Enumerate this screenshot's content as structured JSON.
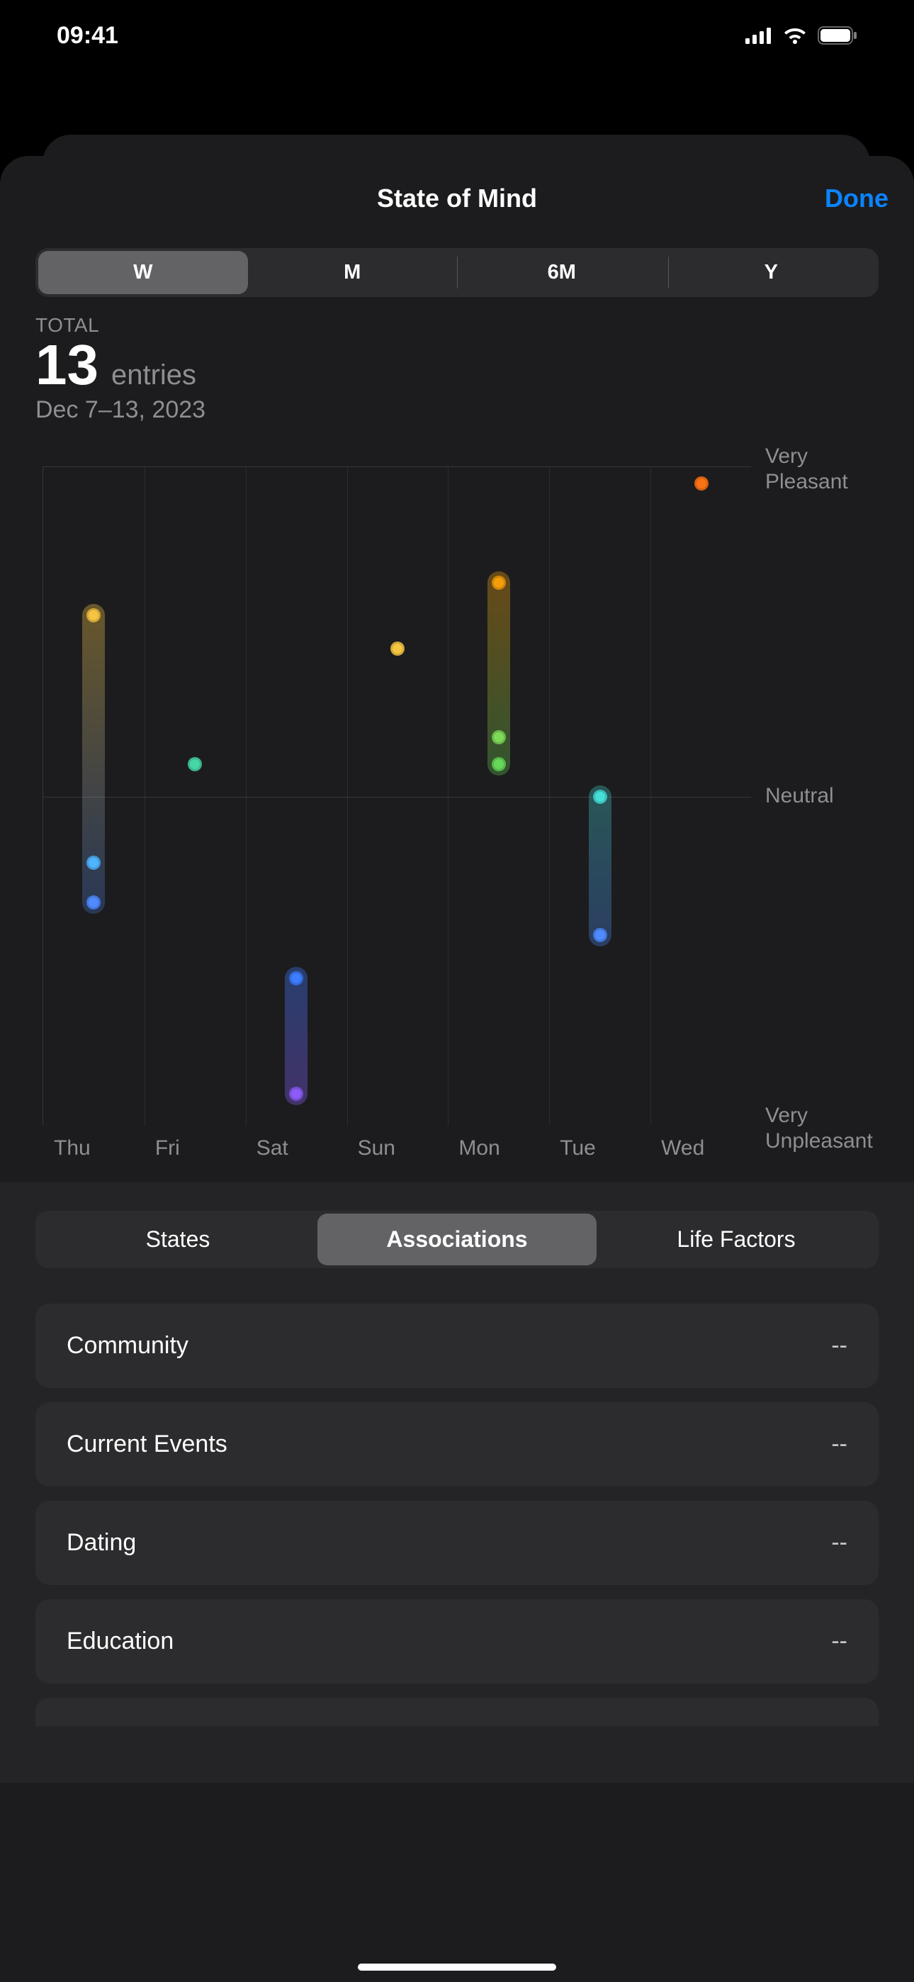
{
  "status": {
    "time": "09:41"
  },
  "sheet": {
    "title": "State of Mind",
    "done": "Done"
  },
  "range_seg": {
    "items": [
      "W",
      "M",
      "6M",
      "Y"
    ],
    "selected": 0
  },
  "summary": {
    "label": "TOTAL",
    "value": "13",
    "unit": "entries",
    "range": "Dec 7–13, 2023"
  },
  "chart_data": {
    "type": "scatter",
    "title": "",
    "xlabel": "",
    "ylabel": "",
    "ylim": [
      -1,
      1
    ],
    "y_ticks": [
      {
        "v": 1,
        "label": "Very\nPleasant"
      },
      {
        "v": 0,
        "label": "Neutral"
      },
      {
        "v": -1,
        "label": "Very\nUnpleasant"
      }
    ],
    "categories": [
      "Thu",
      "Fri",
      "Sat",
      "Sun",
      "Mon",
      "Tue",
      "Wed"
    ],
    "series": [
      {
        "name": "state-of-mind",
        "points": [
          {
            "x": 0,
            "y": 0.55,
            "color": "#f5c542"
          },
          {
            "x": 0,
            "y": -0.2,
            "color": "#4fb3ff"
          },
          {
            "x": 0,
            "y": -0.32,
            "color": "#4f8bff"
          },
          {
            "x": 1,
            "y": 0.1,
            "color": "#47d6a5"
          },
          {
            "x": 2,
            "y": -0.55,
            "color": "#3d7dff"
          },
          {
            "x": 2,
            "y": -0.9,
            "color": "#8b5cf6"
          },
          {
            "x": 3,
            "y": 0.45,
            "color": "#f5c542"
          },
          {
            "x": 4,
            "y": 0.65,
            "color": "#f59e0b"
          },
          {
            "x": 4,
            "y": 0.18,
            "color": "#7ed957"
          },
          {
            "x": 4,
            "y": 0.1,
            "color": "#65d957"
          },
          {
            "x": 5,
            "y": 0.0,
            "color": "#45e0d8"
          },
          {
            "x": 5,
            "y": -0.42,
            "color": "#4f8bff"
          },
          {
            "x": 6,
            "y": 0.95,
            "color": "#f97316"
          }
        ]
      }
    ],
    "tracks": [
      {
        "x": 0,
        "top_y": 0.55,
        "bot_y": -0.32,
        "gradient": [
          "rgba(245,197,66,0.35)",
          "rgba(79,139,255,0.25)"
        ]
      },
      {
        "x": 2,
        "top_y": -0.55,
        "bot_y": -0.9,
        "gradient": [
          "rgba(61,125,255,0.35)",
          "rgba(139,92,246,0.35)"
        ]
      },
      {
        "x": 4,
        "top_y": 0.65,
        "bot_y": 0.1,
        "gradient": [
          "rgba(245,158,11,0.35)",
          "rgba(101,217,87,0.3)"
        ]
      },
      {
        "x": 5,
        "top_y": 0.0,
        "bot_y": -0.42,
        "gradient": [
          "rgba(69,224,216,0.3)",
          "rgba(79,139,255,0.3)"
        ]
      }
    ]
  },
  "detail_seg": {
    "items": [
      "States",
      "Associations",
      "Life Factors"
    ],
    "selected": 1
  },
  "associations": [
    {
      "label": "Community",
      "value": "--"
    },
    {
      "label": "Current Events",
      "value": "--"
    },
    {
      "label": "Dating",
      "value": "--"
    },
    {
      "label": "Education",
      "value": "--"
    }
  ]
}
